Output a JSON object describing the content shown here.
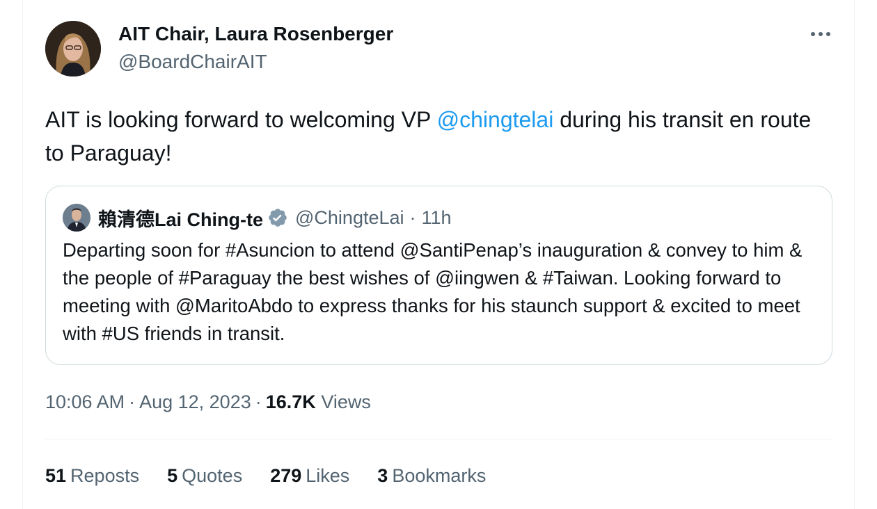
{
  "author": {
    "display_name": "AIT Chair, Laura Rosenberger",
    "handle": "@BoardChairAIT",
    "avatar_icon": "profile-photo"
  },
  "more_icon": "ellipsis-icon",
  "tweet": {
    "text_before": "AIT is looking forward to welcoming VP ",
    "mention": "@chingtelai",
    "text_after": " during his transit en route to Paraguay!"
  },
  "quote": {
    "display_name": "賴清德Lai Ching-te",
    "handle": "@ChingteLai",
    "separator": "·",
    "time": "11h",
    "text": "Departing soon for #Asuncion to attend @SantiPenap’s inauguration & convey to him & the people of #Paraguay the best wishes of @iingwen & #Taiwan. Looking forward to meeting with @MaritoAbdo to express thanks for his staunch support & excited to meet with #US friends in transit."
  },
  "meta": {
    "time": "10:06 AM",
    "separator": "·",
    "date": "Aug 12, 2023",
    "views_count": "16.7K",
    "views_label": "Views"
  },
  "stats": [
    {
      "count": "51",
      "label": "Reposts"
    },
    {
      "count": "5",
      "label": "Quotes"
    },
    {
      "count": "279",
      "label": "Likes"
    },
    {
      "count": "3",
      "label": "Bookmarks"
    }
  ],
  "colors": {
    "text": "#0f1419",
    "secondary": "#536471",
    "accent": "#1d9bf0",
    "border": "#cfd9de"
  }
}
